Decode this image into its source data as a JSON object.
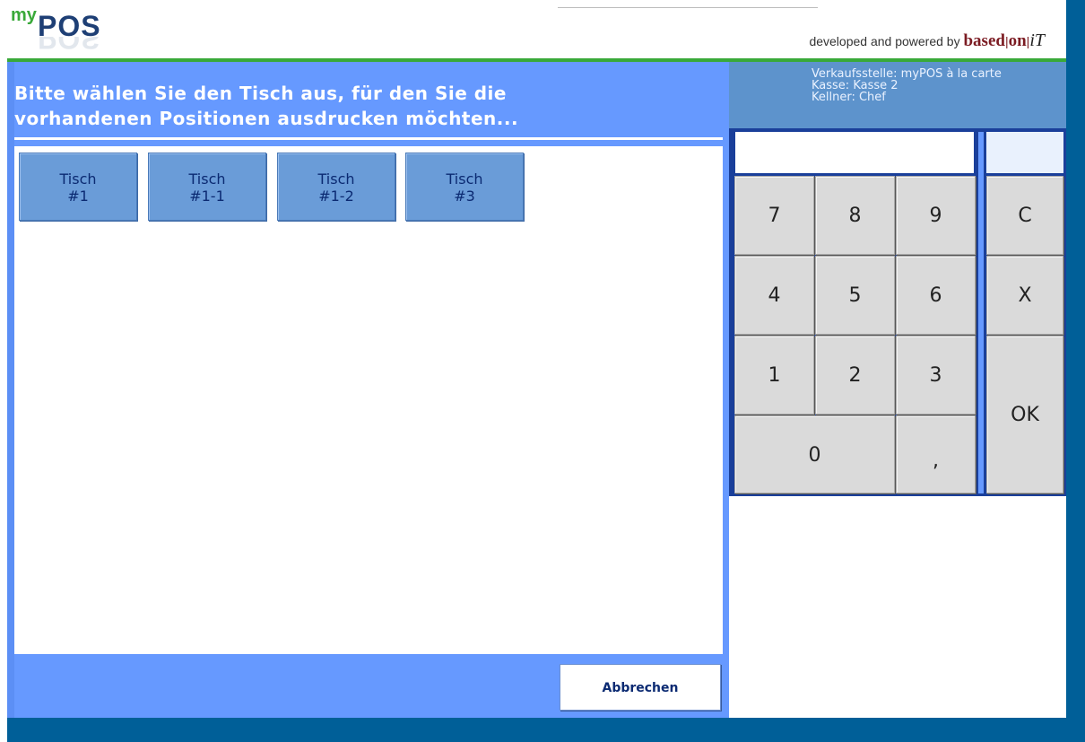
{
  "header": {
    "logo_my": "my",
    "logo_pos": "POS",
    "powered_prefix": "developed and powered by ",
    "brand_based": "based",
    "brand_sep": "|",
    "brand_on": "on",
    "brand_it": "iT"
  },
  "main": {
    "title_line1": "Bitte wählen Sie den Tisch aus, für den Sie die",
    "title_line2": "vorhandenen Positionen ausdrucken möchten...",
    "tables": [
      {
        "line1": "Tisch",
        "line2": "#1"
      },
      {
        "line1": "Tisch",
        "line2": "#1-1"
      },
      {
        "line1": "Tisch",
        "line2": "#1-2"
      },
      {
        "line1": "Tisch",
        "line2": "#3"
      }
    ],
    "cancel_label": "Abbrechen"
  },
  "info": {
    "verkaufsstelle": "Verkaufsstelle: myPOS à la carte",
    "kasse": "Kasse: Kasse 2",
    "kellner": "Kellner: Chef"
  },
  "keypad": {
    "display_value": "",
    "keys": {
      "k7": "7",
      "k8": "8",
      "k9": "9",
      "clear": "C",
      "k4": "4",
      "k5": "5",
      "k6": "6",
      "delete": "X",
      "k1": "1",
      "k2": "2",
      "k3": "3",
      "ok": "OK",
      "k0": "0",
      "comma": ","
    }
  },
  "colors": {
    "panel_blue": "#6699ff",
    "dark_blue": "#005f98",
    "green": "#39a939",
    "key_gray": "#dadada"
  }
}
